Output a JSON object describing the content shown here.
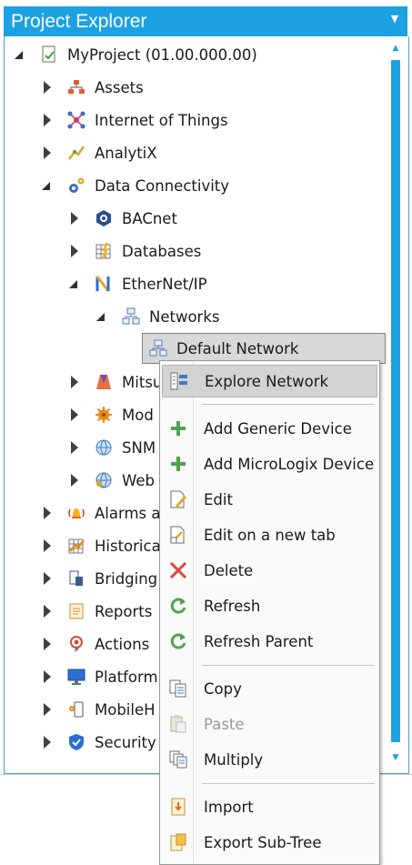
{
  "panel": {
    "title": "Project Explorer",
    "accent": "#1ca1e2"
  },
  "tree": [
    {
      "label": "MyProject (01.00.000.00)",
      "icon": "project-icon",
      "state": "expanded"
    },
    {
      "label": "Assets",
      "icon": "assets-icon",
      "state": "collapsed"
    },
    {
      "label": "Internet of Things",
      "icon": "iot-icon",
      "state": "collapsed"
    },
    {
      "label": "AnalytiX",
      "icon": "analytix-icon",
      "state": "collapsed"
    },
    {
      "label": "Data Connectivity",
      "icon": "data-connectivity-icon",
      "state": "expanded"
    },
    {
      "label": "BACnet",
      "icon": "bacnet-icon",
      "state": "collapsed"
    },
    {
      "label": "Databases",
      "icon": "databases-icon",
      "state": "collapsed"
    },
    {
      "label": "EtherNet/IP",
      "icon": "ethernetip-icon",
      "state": "expanded"
    },
    {
      "label": "Networks",
      "icon": "networks-icon",
      "state": "expanded"
    },
    {
      "label": "Default Network",
      "icon": "network-icon",
      "state": "selected"
    },
    {
      "label": "Mitsu",
      "icon": "mitsubishi-icon",
      "state": "collapsed"
    },
    {
      "label": "Mod",
      "icon": "modbus-icon",
      "state": "collapsed"
    },
    {
      "label": "SNM",
      "icon": "snmp-icon",
      "state": "collapsed"
    },
    {
      "label": "Web",
      "icon": "web-icon",
      "state": "collapsed"
    },
    {
      "label": "Alarms a",
      "icon": "alarms-icon",
      "state": "collapsed"
    },
    {
      "label": "Historica",
      "icon": "historical-icon",
      "state": "collapsed"
    },
    {
      "label": "Bridging",
      "icon": "bridging-icon",
      "state": "collapsed"
    },
    {
      "label": "Reports",
      "icon": "reports-icon",
      "state": "collapsed"
    },
    {
      "label": "Actions",
      "icon": "actions-icon",
      "state": "collapsed"
    },
    {
      "label": "Platform",
      "icon": "platform-icon",
      "state": "collapsed"
    },
    {
      "label": "MobileH",
      "icon": "mobile-icon",
      "state": "collapsed"
    },
    {
      "label": "Security",
      "icon": "security-icon",
      "state": "collapsed"
    }
  ],
  "menu": [
    {
      "label": "Explore Network",
      "icon": "explore-network-icon",
      "highlighted": true
    },
    {
      "label": "Add Generic Device",
      "icon": "plus-icon"
    },
    {
      "label": "Add MicroLogix Device",
      "icon": "plus-icon"
    },
    {
      "label": "Edit",
      "icon": "edit-icon"
    },
    {
      "label": "Edit on a new tab",
      "icon": "edit-new-tab-icon"
    },
    {
      "label": "Delete",
      "icon": "delete-icon"
    },
    {
      "label": "Refresh",
      "icon": "refresh-icon"
    },
    {
      "label": "Refresh Parent",
      "icon": "refresh-parent-icon"
    },
    {
      "label": "Copy",
      "icon": "copy-icon"
    },
    {
      "label": "Paste",
      "icon": "paste-icon",
      "disabled": true
    },
    {
      "label": "Multiply",
      "icon": "multiply-icon"
    },
    {
      "label": "Import",
      "icon": "import-icon"
    },
    {
      "label": "Export Sub-Tree",
      "icon": "export-icon"
    }
  ]
}
